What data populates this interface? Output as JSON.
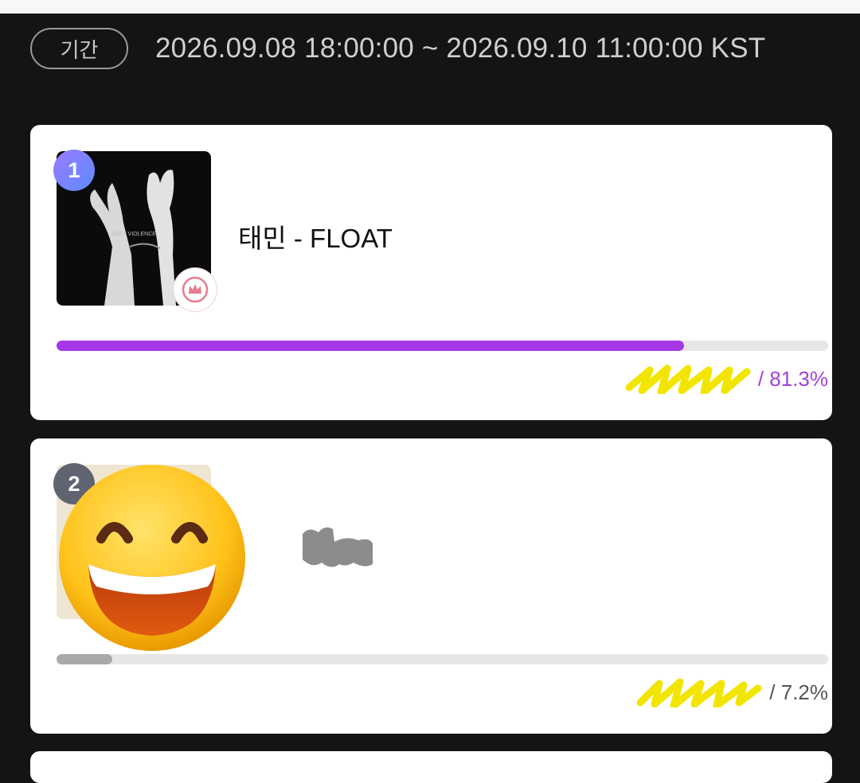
{
  "period": {
    "label": "기간",
    "range": "2026.09.08 18:00:00 ~ 2026.09.10 11:00:00 KST"
  },
  "rankings": [
    {
      "rank": "1",
      "title": "태민 - FLOAT",
      "percent": "81.3%",
      "percent_value": 81.3,
      "vote_suffix": " / 81.3%",
      "album_text": "SOFT VIOLENCE",
      "icons": {
        "badge": "crown-icon"
      },
      "colors": {
        "bar": "#a637e6",
        "text": "#a340d9"
      }
    },
    {
      "rank": "2",
      "title": "",
      "percent": "7.2%",
      "percent_value": 7.2,
      "vote_suffix": " / 7.2%",
      "icons": {
        "cover_overlay": "grinning-face-emoji"
      },
      "colors": {
        "bar": "#a9a9a9",
        "text": "#555555"
      }
    }
  ]
}
